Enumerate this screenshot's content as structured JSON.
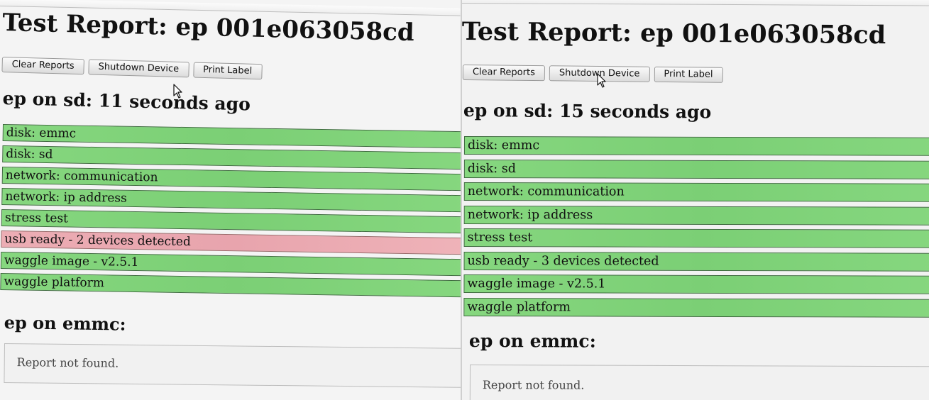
{
  "left": {
    "title": "Test Report: ep 001e063058cd",
    "buttons": {
      "clear": "Clear Reports",
      "shutdown": "Shutdown Device",
      "print": "Print Label"
    },
    "sd_heading": "ep on sd: 11 seconds ago",
    "tests": [
      {
        "label": "disk: emmc",
        "status": "pass"
      },
      {
        "label": "disk: sd",
        "status": "pass"
      },
      {
        "label": "network: communication",
        "status": "pass"
      },
      {
        "label": "network: ip address",
        "status": "pass"
      },
      {
        "label": "stress test",
        "status": "pass"
      },
      {
        "label": "usb ready - 2 devices detected",
        "status": "fail"
      },
      {
        "label": "waggle image - v2.5.1",
        "status": "pass"
      },
      {
        "label": "waggle platform",
        "status": "pass"
      }
    ],
    "emmc_heading": "ep on emmc:",
    "emmc_message": "Report not found."
  },
  "right": {
    "title": "Test Report: ep 001e063058cd",
    "buttons": {
      "clear": "Clear Reports",
      "shutdown": "Shutdown Device",
      "print": "Print Label"
    },
    "sd_heading": "ep on sd: 15 seconds ago",
    "tests": [
      {
        "label": "disk: emmc",
        "status": "pass"
      },
      {
        "label": "disk: sd",
        "status": "pass"
      },
      {
        "label": "network: communication",
        "status": "pass"
      },
      {
        "label": "network: ip address",
        "status": "pass"
      },
      {
        "label": "stress test",
        "status": "pass"
      },
      {
        "label": "usb ready - 3 devices detected",
        "status": "pass"
      },
      {
        "label": "waggle image - v2.5.1",
        "status": "pass"
      },
      {
        "label": "waggle platform",
        "status": "pass"
      }
    ],
    "emmc_heading": "ep on emmc:",
    "emmc_message": "Report not found."
  },
  "colors": {
    "pass": "#7fd27a",
    "fail": "#eaa8b0"
  },
  "icons": {
    "cursor": "mouse-pointer-icon"
  }
}
